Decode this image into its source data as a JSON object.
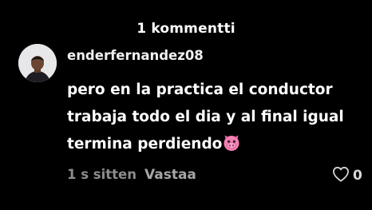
{
  "header": {
    "title": "1 kommentti"
  },
  "comment": {
    "username": "enderfernandez08",
    "text_line1": "pero en la practica el conductor",
    "text_line2": "trabaja todo el dia y al final igual",
    "text_line3": "termina perdiendo",
    "emoji_icon": "pig-face-emoji",
    "time": "1 s sitten",
    "reply_label": "Vastaa",
    "like_icon": "heart-outline-icon",
    "like_count": "0"
  },
  "colors": {
    "background": "#000000",
    "text_primary": "#ffffff",
    "text_secondary": "#8c8c8c",
    "reply": "#a6a6a6",
    "emoji_pink": "#f47fb1"
  }
}
